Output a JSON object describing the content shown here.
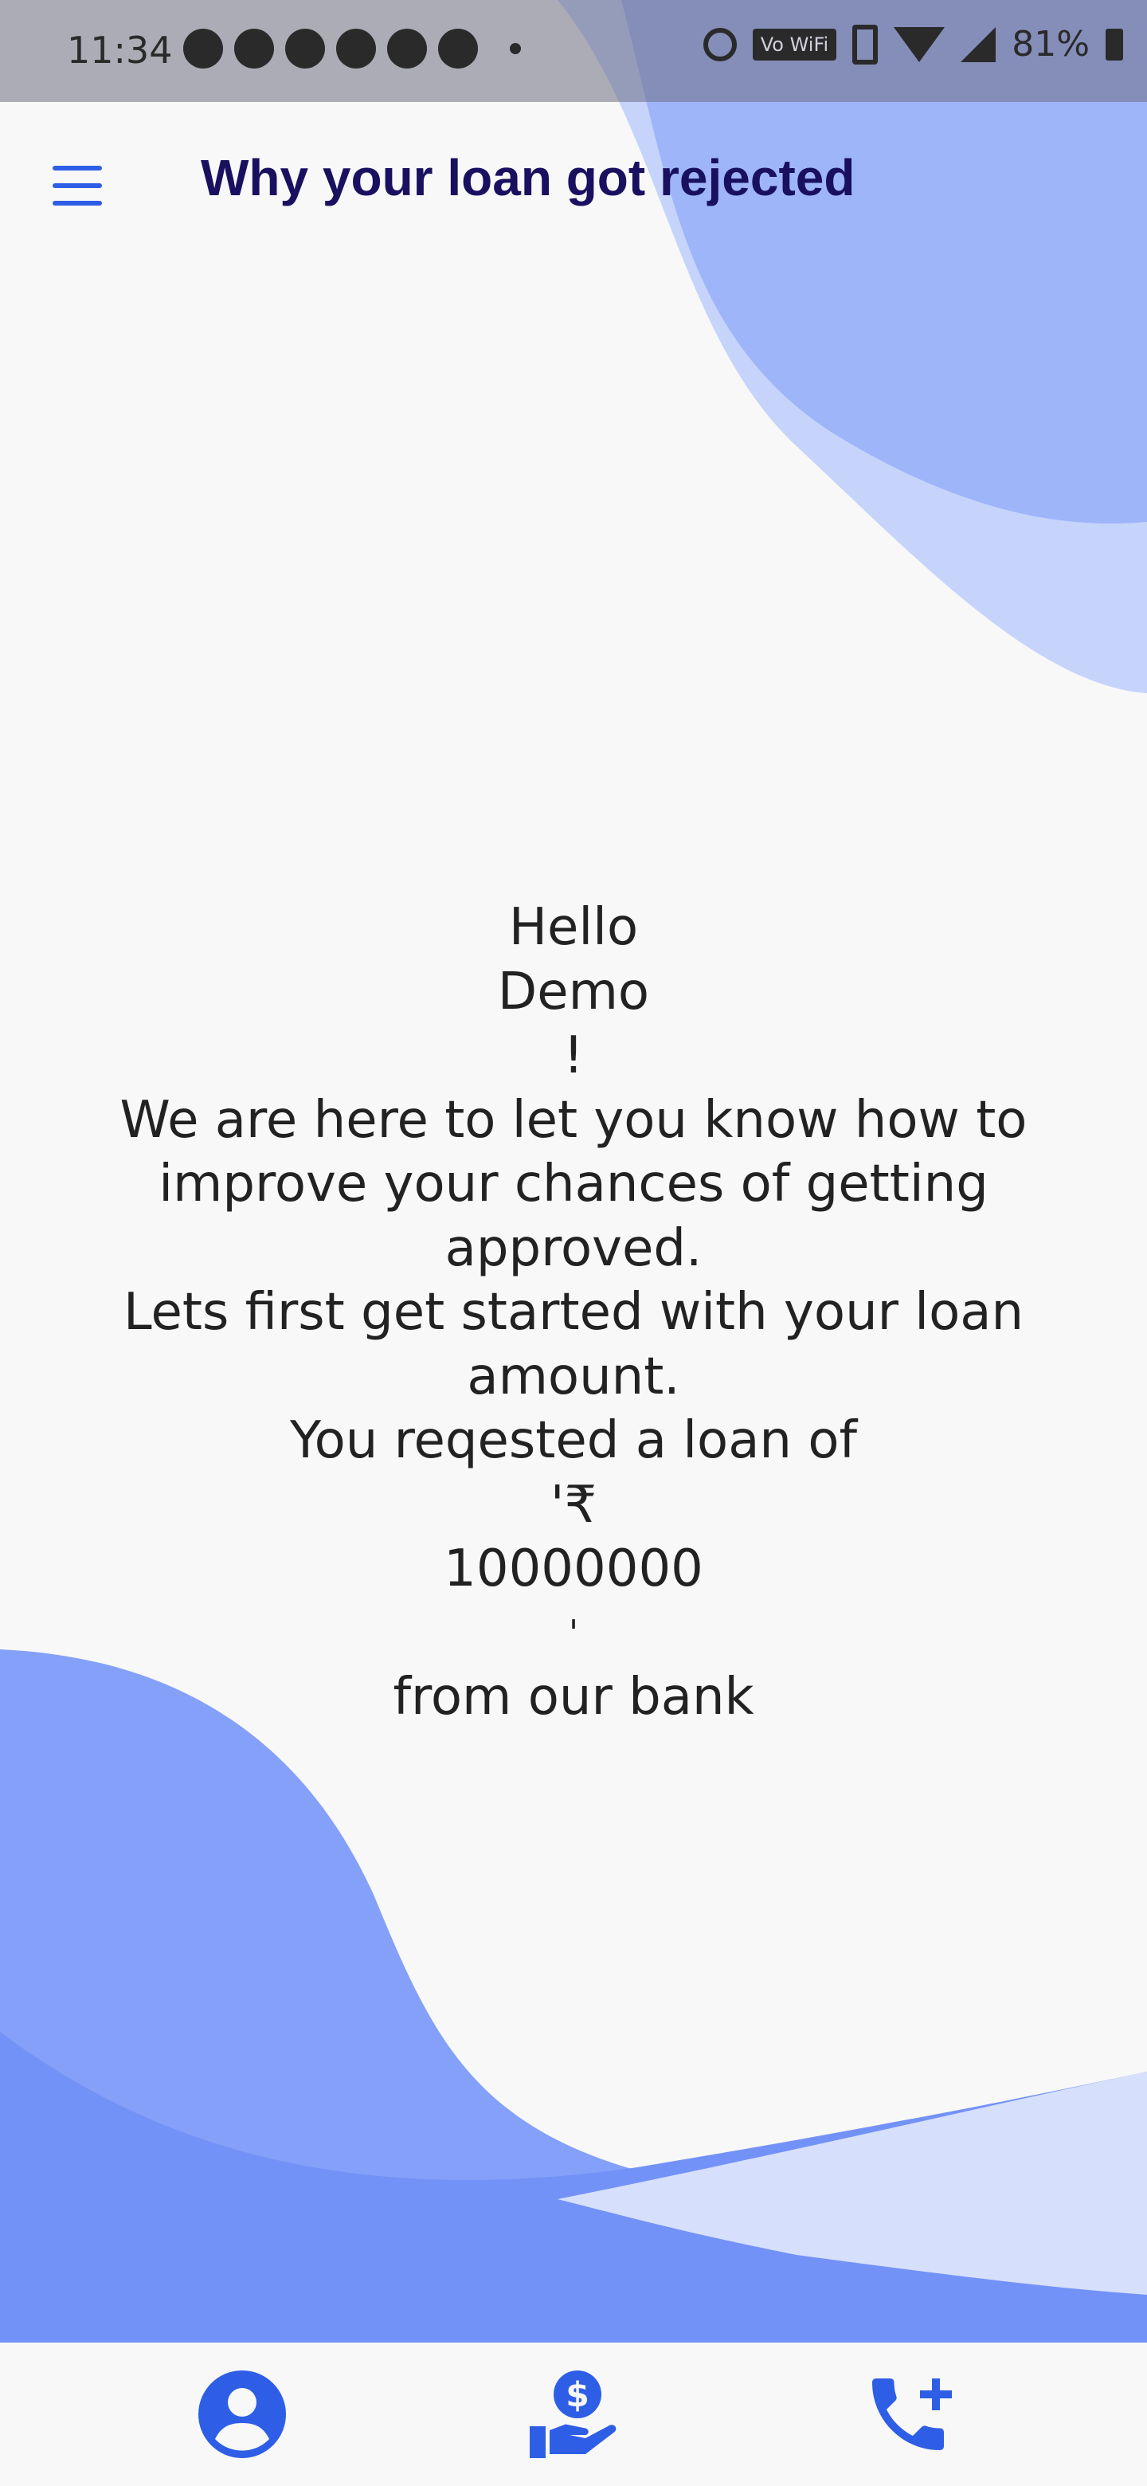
{
  "status_bar": {
    "time": "11:34",
    "vowifi_label": "Vo WiFi",
    "battery": "81%"
  },
  "app_bar": {
    "menu_icon": "menu-icon",
    "title": "Why your loan got rejected"
  },
  "message": {
    "greeting": "Hello",
    "name": "Demo",
    "exclaim": "!",
    "intro": "We are here to let you know how to improve your chances of getting approved.",
    "loan_prompt": "Lets first get started with your loan amount.",
    "requested_text": "You reqested a loan of",
    "currency": "'₹",
    "amount": "10000000",
    "quote_close": "'",
    "from_bank": "from our bank"
  },
  "bottom_nav": {
    "items": [
      {
        "icon": "profile-icon"
      },
      {
        "icon": "loan-payment-icon"
      },
      {
        "icon": "add-call-icon"
      }
    ]
  },
  "colors": {
    "accent": "#2f5ee6",
    "title": "#1a1060",
    "wave_dark": "#6b8ef7",
    "wave_light": "#b9c9fb"
  }
}
